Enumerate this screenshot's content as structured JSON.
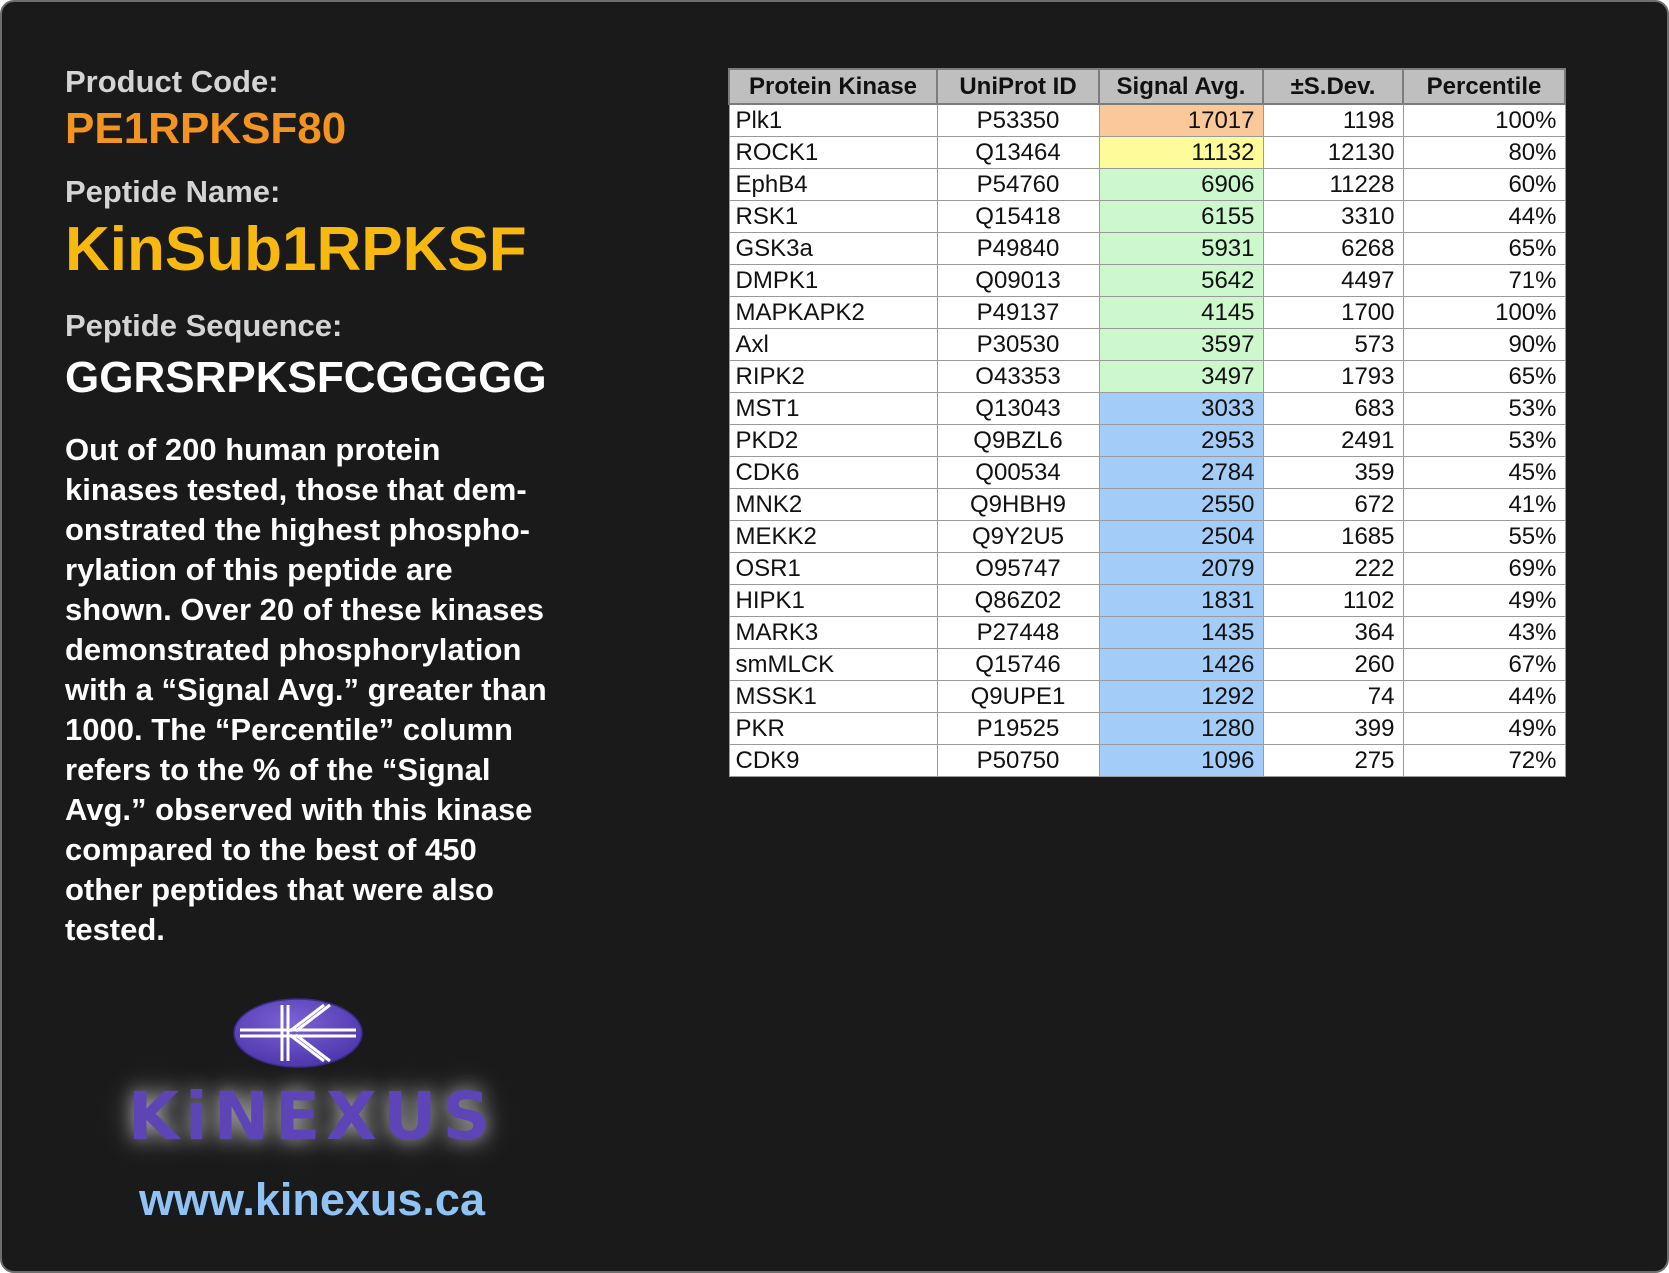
{
  "product": {
    "code_label": "Product Code:",
    "code": "PE1RPKSF80",
    "name_label": "Peptide Name:",
    "name": "KinSub1RPKSF",
    "sequence_label": "Peptide Sequence:",
    "sequence": "GGRSRPKSFCGGGGG"
  },
  "description_lines": [
    "Out of 200 human protein",
    "kinases tested, those that dem-",
    "onstrated the highest phospho-",
    "rylation of this peptide are",
    "shown. Over 20 of these kinases",
    "demonstrated phosphorylation",
    "with a “Signal Avg.” greater than",
    "1000. The “Percentile” column",
    "refers to the % of the “Signal",
    "Avg.” observed with this kinase",
    "compared to the best of 450",
    "other peptides that were also",
    "tested."
  ],
  "logo": {
    "wordmark": "KiNEXUS",
    "website": "www.kinexus.ca"
  },
  "colors": {
    "code": "#f39420",
    "name": "#f7b90f",
    "website": "#8fc3f5",
    "logo_purple": "#5d45b7",
    "signal_orange": "#fbc89a",
    "signal_yellow": "#fdfb9a",
    "signal_green": "#cdf7cc",
    "signal_blue": "#a3cdf8"
  },
  "table": {
    "headers": [
      "Protein Kinase",
      "UniProt ID",
      "Signal Avg.",
      "±S.Dev.",
      "Percentile"
    ],
    "rows": [
      {
        "kinase": "Plk1",
        "uniprot": "P53350",
        "signal": "17017",
        "sdev": "1198",
        "percentile": "100%",
        "band": "orange"
      },
      {
        "kinase": "ROCK1",
        "uniprot": "Q13464",
        "signal": "11132",
        "sdev": "12130",
        "percentile": "80%",
        "band": "yellow"
      },
      {
        "kinase": "EphB4",
        "uniprot": "P54760",
        "signal": "6906",
        "sdev": "11228",
        "percentile": "60%",
        "band": "green"
      },
      {
        "kinase": "RSK1",
        "uniprot": "Q15418",
        "signal": "6155",
        "sdev": "3310",
        "percentile": "44%",
        "band": "green"
      },
      {
        "kinase": "GSK3a",
        "uniprot": "P49840",
        "signal": "5931",
        "sdev": "6268",
        "percentile": "65%",
        "band": "green"
      },
      {
        "kinase": "DMPK1",
        "uniprot": "Q09013",
        "signal": "5642",
        "sdev": "4497",
        "percentile": "71%",
        "band": "green"
      },
      {
        "kinase": "MAPKAPK2",
        "uniprot": "P49137",
        "signal": "4145",
        "sdev": "1700",
        "percentile": "100%",
        "band": "green"
      },
      {
        "kinase": "Axl",
        "uniprot": "P30530",
        "signal": "3597",
        "sdev": "573",
        "percentile": "90%",
        "band": "green"
      },
      {
        "kinase": "RIPK2",
        "uniprot": "O43353",
        "signal": "3497",
        "sdev": "1793",
        "percentile": "65%",
        "band": "green"
      },
      {
        "kinase": "MST1",
        "uniprot": "Q13043",
        "signal": "3033",
        "sdev": "683",
        "percentile": "53%",
        "band": "blue"
      },
      {
        "kinase": "PKD2",
        "uniprot": "Q9BZL6",
        "signal": "2953",
        "sdev": "2491",
        "percentile": "53%",
        "band": "blue"
      },
      {
        "kinase": "CDK6",
        "uniprot": "Q00534",
        "signal": "2784",
        "sdev": "359",
        "percentile": "45%",
        "band": "blue"
      },
      {
        "kinase": "MNK2",
        "uniprot": "Q9HBH9",
        "signal": "2550",
        "sdev": "672",
        "percentile": "41%",
        "band": "blue"
      },
      {
        "kinase": "MEKK2",
        "uniprot": "Q9Y2U5",
        "signal": "2504",
        "sdev": "1685",
        "percentile": "55%",
        "band": "blue"
      },
      {
        "kinase": "OSR1",
        "uniprot": "O95747",
        "signal": "2079",
        "sdev": "222",
        "percentile": "69%",
        "band": "blue"
      },
      {
        "kinase": "HIPK1",
        "uniprot": "Q86Z02",
        "signal": "1831",
        "sdev": "1102",
        "percentile": "49%",
        "band": "blue"
      },
      {
        "kinase": "MARK3",
        "uniprot": "P27448",
        "signal": "1435",
        "sdev": "364",
        "percentile": "43%",
        "band": "blue"
      },
      {
        "kinase": "smMLCK",
        "uniprot": "Q15746",
        "signal": "1426",
        "sdev": "260",
        "percentile": "67%",
        "band": "blue"
      },
      {
        "kinase": "MSSK1",
        "uniprot": "Q9UPE1",
        "signal": "1292",
        "sdev": "74",
        "percentile": "44%",
        "band": "blue"
      },
      {
        "kinase": "PKR",
        "uniprot": "P19525",
        "signal": "1280",
        "sdev": "399",
        "percentile": "49%",
        "band": "blue"
      },
      {
        "kinase": "CDK9",
        "uniprot": "P50750",
        "signal": "1096",
        "sdev": "275",
        "percentile": "72%",
        "band": "blue"
      }
    ]
  }
}
